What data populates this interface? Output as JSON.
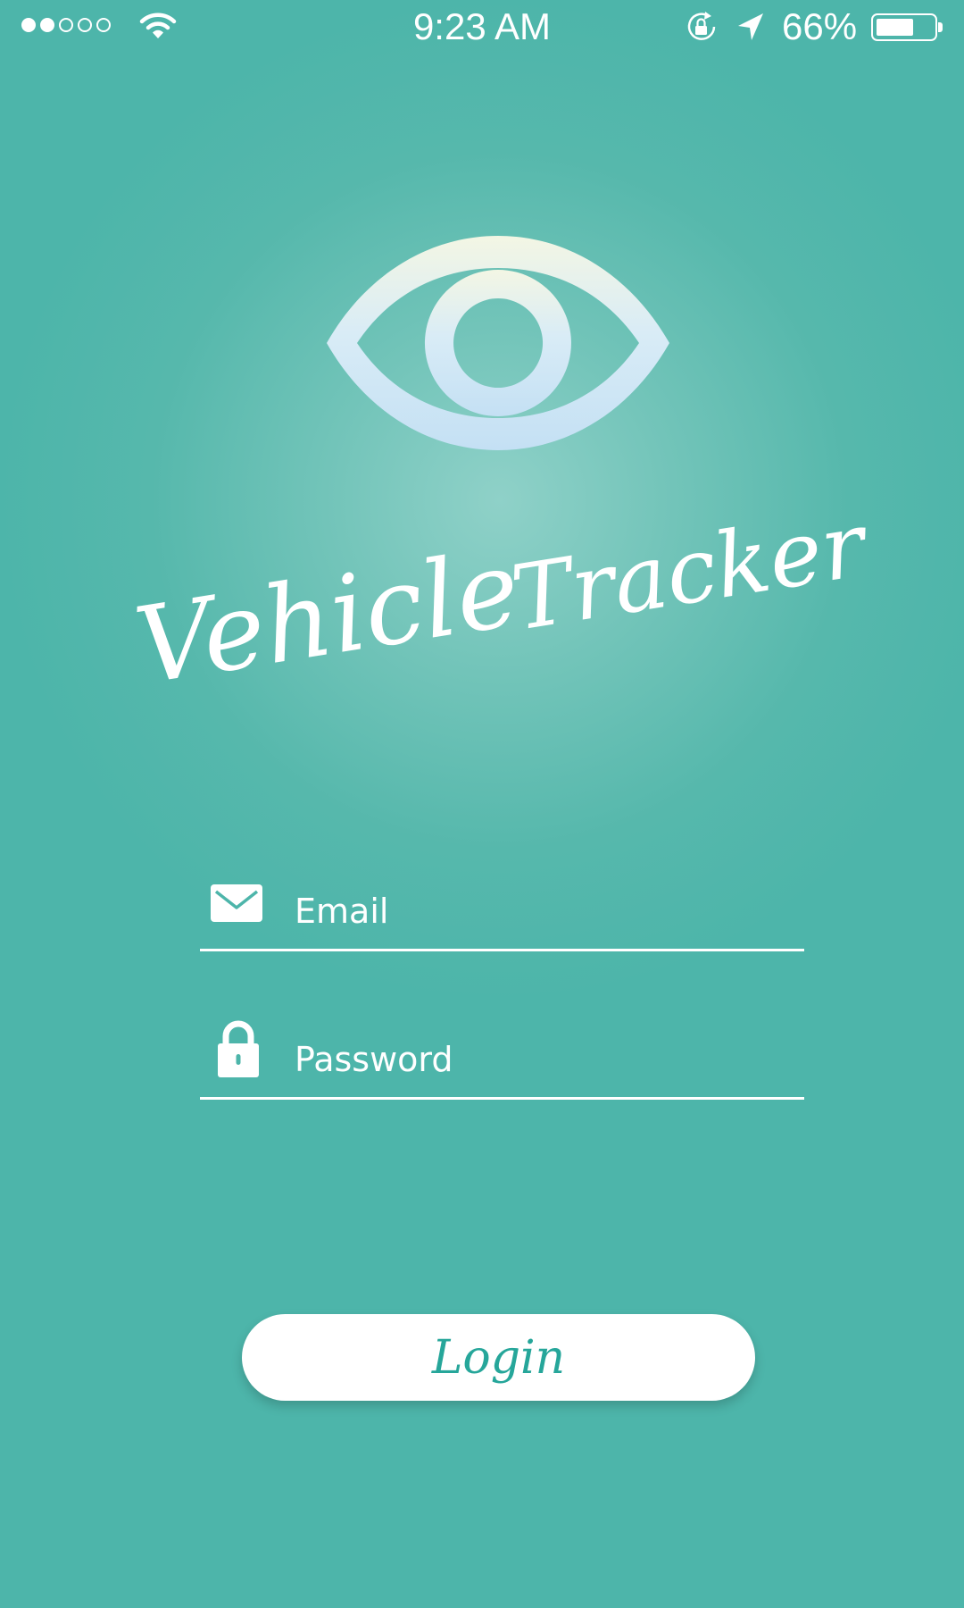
{
  "status_bar": {
    "signal_icon": "signal-dots-icon",
    "signal_strength": 2,
    "signal_total": 5,
    "wifi_icon": "wifi-icon",
    "time": "9:23 AM",
    "rotation_lock_icon": "rotation-lock-icon",
    "location_icon": "location-arrow-icon",
    "battery_percent": "66%",
    "battery_level": 0.66,
    "battery_icon": "battery-icon"
  },
  "logo": {
    "icon": "eye-icon"
  },
  "app": {
    "title_word1": "Vehicle",
    "title_word2": "Tracker"
  },
  "form": {
    "email": {
      "icon": "envelope-icon",
      "placeholder": "Email",
      "value": ""
    },
    "password": {
      "icon": "lock-icon",
      "placeholder": "Password",
      "value": ""
    }
  },
  "actions": {
    "login_label": "Login"
  },
  "colors": {
    "background": "#4db5aa",
    "background_glow": "#8fd1c8",
    "accent": "#26a69a",
    "foreground": "#ffffff"
  }
}
